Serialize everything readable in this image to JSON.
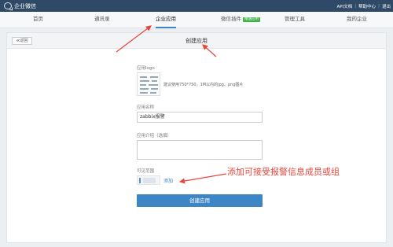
{
  "topbar": {
    "brand": "企业微信",
    "links": [
      "API文档",
      "帮助中心",
      "退出"
    ]
  },
  "nav": {
    "items": [
      "首页",
      "通讯录",
      "企业应用",
      "微信插件",
      "管理工具",
      "我的企业"
    ],
    "active": "企业应用",
    "badge": "赠送应用"
  },
  "page": {
    "back": "≪返回",
    "title": "创建应用"
  },
  "form": {
    "logo_label": "应用logo",
    "logo_hint": "建议使用750*750，1M以内的jpg、png图片",
    "name_label": "应用名称",
    "name_value": "zabbix报警",
    "intro_label": "应用介绍（选填）",
    "intro_value": "",
    "scope_label": "可见范围",
    "add_link": "添加",
    "submit": "创建应用"
  },
  "annotation": {
    "text": "添加可接受报警信息成员或组",
    "color": "#e8453c"
  },
  "colors": {
    "topbar": "#2f4a67",
    "primary": "#3d86c6",
    "badge": "#3fb04a"
  }
}
